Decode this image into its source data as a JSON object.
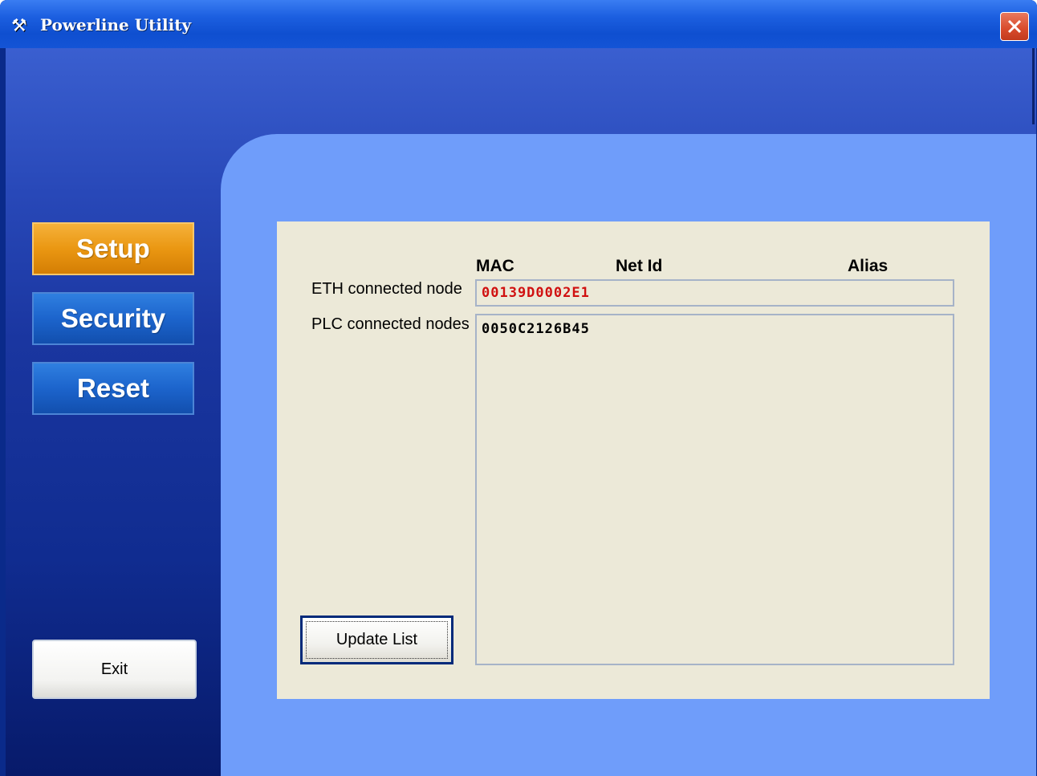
{
  "window": {
    "title": "Powerline Utility",
    "app_icon": "tools-icon",
    "close_icon": "close-icon"
  },
  "sidebar": {
    "items": [
      {
        "label": "Setup",
        "active": true
      },
      {
        "label": "Security",
        "active": false
      },
      {
        "label": "Reset",
        "active": false
      }
    ],
    "exit_label": "Exit"
  },
  "table": {
    "headers": {
      "mac": "MAC",
      "net_id": "Net Id",
      "alias": "Alias"
    },
    "eth_label": "ETH connected node",
    "eth_value": "00139D0002E1",
    "plc_label": "PLC connected nodes",
    "plc_nodes": [
      "0050C2126B45"
    ]
  },
  "update_button_label": "Update List",
  "colors": {
    "accent_active": "#ea9712",
    "nav_blue": "#1c64cc",
    "panel_blue": "#6f9dfa",
    "eth_value_color": "#d01010"
  }
}
